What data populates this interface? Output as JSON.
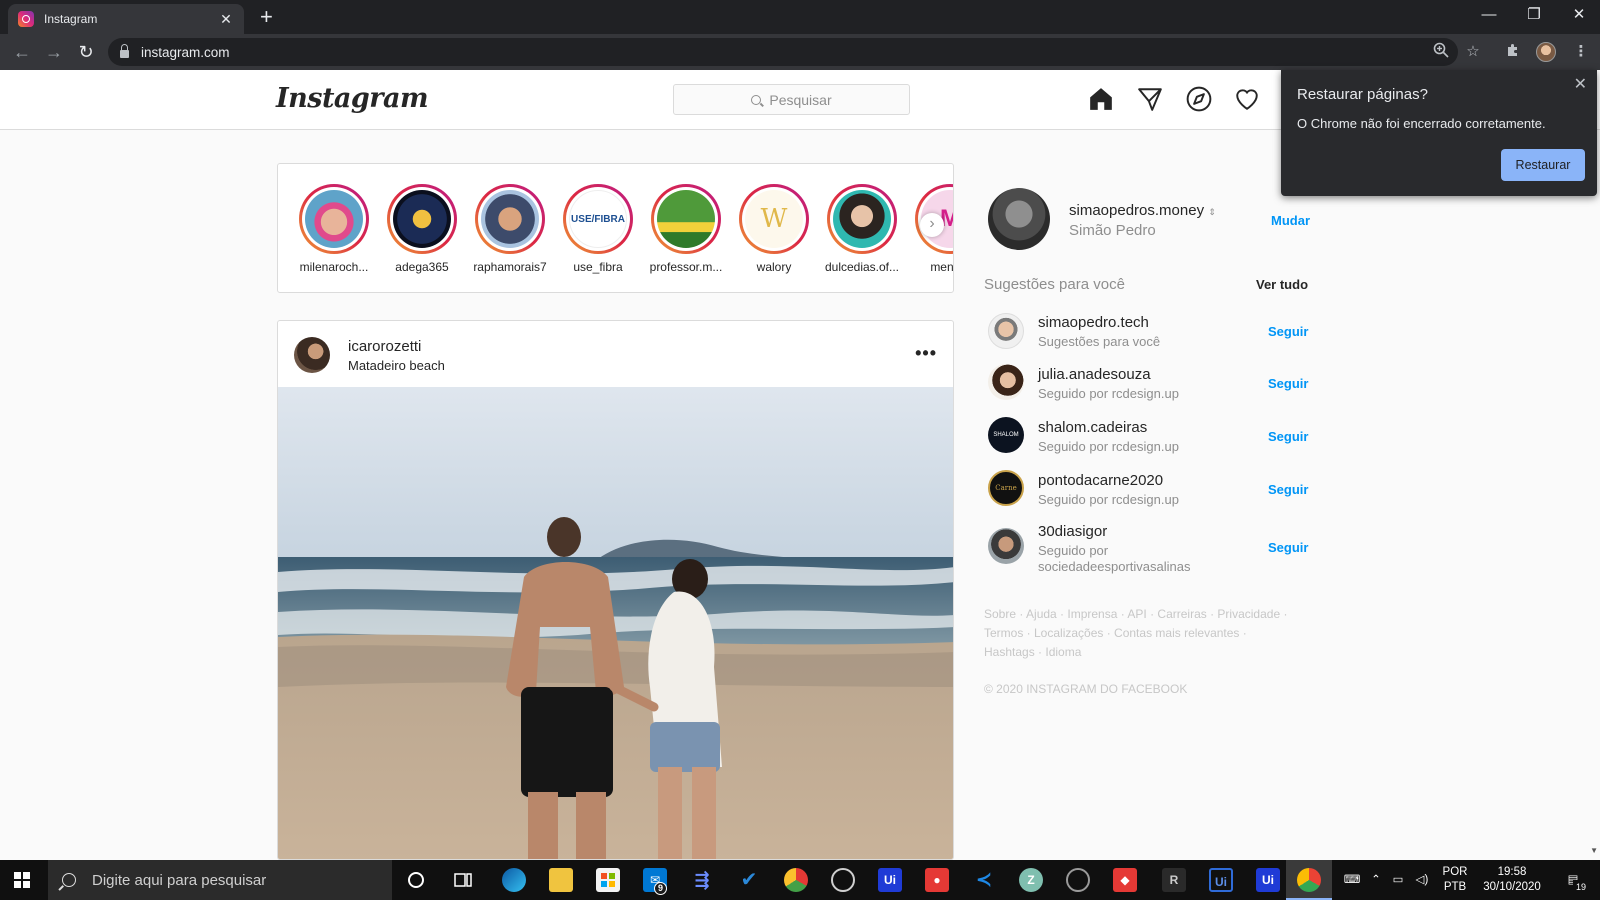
{
  "browser": {
    "tab_title": "Instagram",
    "tab_close": "✕",
    "new_tab": "+",
    "url": "instagram.com",
    "window_controls": {
      "minimize": "—",
      "restore": "❐",
      "close": "✕"
    }
  },
  "header": {
    "logo": "Instagram",
    "search_placeholder": "Pesquisar"
  },
  "stories": [
    {
      "name": "milenaroch..."
    },
    {
      "name": "adega365"
    },
    {
      "name": "raphamorais7"
    },
    {
      "name": "use_fibra"
    },
    {
      "name": "professor.m..."
    },
    {
      "name": "walory"
    },
    {
      "name": "dulcedias.of..."
    },
    {
      "name": "menina"
    }
  ],
  "post": {
    "username": "icarorozetti",
    "location": "Matadeiro beach",
    "more": "•••"
  },
  "sidebar": {
    "username": "simaopedros.money",
    "full_name": "Simão Pedro",
    "switch_label": "Mudar",
    "suggestions_title": "Sugestões para você",
    "see_all": "Ver tudo",
    "follow_label": "Seguir",
    "suggestions": [
      {
        "username": "simaopedro.tech",
        "subtitle": "Sugestões para você"
      },
      {
        "username": "julia.anadesouza",
        "subtitle": "Seguido por rcdesign.up"
      },
      {
        "username": "shalom.cadeiras",
        "subtitle": "Seguido por rcdesign.up"
      },
      {
        "username": "pontodacarne2020",
        "subtitle": "Seguido por rcdesign.up"
      },
      {
        "username": "30diasigor",
        "subtitle": "Seguido por sociedadeesportivasalinas"
      }
    ],
    "footer_links": "Sobre · Ajuda · Imprensa · API · Carreiras · Privacidade · Termos · Localizações · Contas mais relevantes · Hashtags · Idioma",
    "copyright": "© 2020 INSTAGRAM DO FACEBOOK"
  },
  "restore_popup": {
    "title": "Restaurar páginas?",
    "message": "O Chrome não foi encerrado corretamente.",
    "button": "Restaurar",
    "close": "✕"
  },
  "taskbar": {
    "search_placeholder": "Digite aqui para pesquisar",
    "mail_badge": "9",
    "language": "POR",
    "layout": "PTB",
    "time": "19:58",
    "date": "30/10/2020",
    "notification_count": "19"
  },
  "colors": {
    "instagram_blue": "#0095f6",
    "chrome_dark": "#202124",
    "restore_button": "#8ab4f8"
  }
}
